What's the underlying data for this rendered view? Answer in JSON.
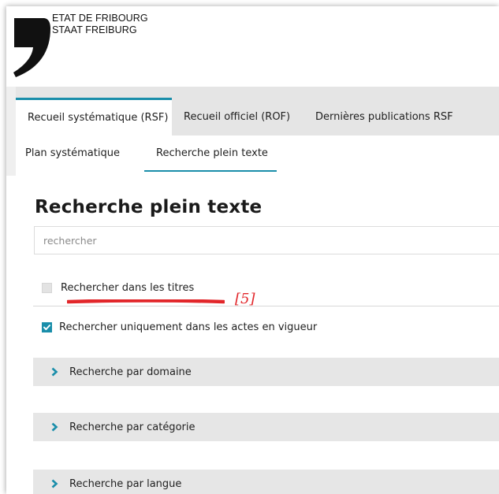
{
  "header": {
    "org_line_1": "ETAT DE FRIBOURG",
    "org_line_2": "STAAT FREIBURG"
  },
  "tabs": [
    {
      "label": "Recueil systématique (RSF)",
      "active": true
    },
    {
      "label": "Recueil officiel (ROF)",
      "active": false
    },
    {
      "label": "Dernières publications RSF",
      "active": false
    }
  ],
  "subtabs": [
    {
      "label": "Plan systématique",
      "active": false
    },
    {
      "label": "Recherche plein texte",
      "active": true
    }
  ],
  "main": {
    "title": "Recherche plein texte",
    "search": {
      "placeholder": "rechercher",
      "value": ""
    },
    "options": [
      {
        "label": "Rechercher dans les titres",
        "checked": false
      },
      {
        "label": "Rechercher uniquement dans les actes en vigueur",
        "checked": true
      }
    ],
    "annotation": "[5]",
    "accordions": [
      {
        "label": "Recherche par domaine"
      },
      {
        "label": "Recherche par catégorie"
      },
      {
        "label": "Recherche par langue"
      }
    ]
  },
  "colors": {
    "accent": "#1a8eaa",
    "annotation_red": "#e2262a",
    "band_gray": "#e5e5e5"
  },
  "icons": {
    "logo": "fribourg-comma-logo-icon",
    "checkbox_checked": "checkmark-icon",
    "accordion": "chevron-right-icon"
  }
}
